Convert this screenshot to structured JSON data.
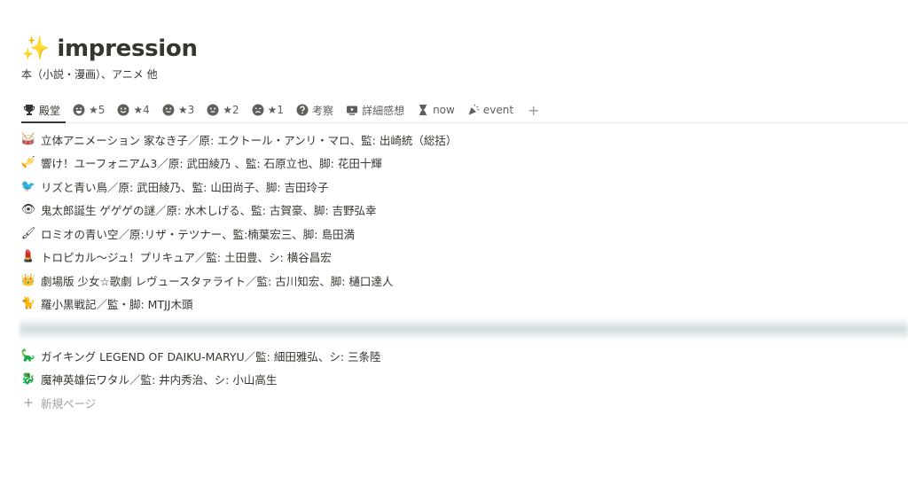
{
  "page": {
    "title_emoji": "✨",
    "title": "impression",
    "subtitle": "本（小説・漫画）、アニメ 他"
  },
  "tabs": [
    {
      "label": "殿堂",
      "icon": "trophy-icon",
      "active": true
    },
    {
      "label": "★5",
      "icon": "grin-face-icon"
    },
    {
      "label": "★4",
      "icon": "smile-face-icon"
    },
    {
      "label": "★3",
      "icon": "neutral-face-icon"
    },
    {
      "label": "★2",
      "icon": "meh-face-icon"
    },
    {
      "label": "★1",
      "icon": "sad-face-icon"
    },
    {
      "label": "考察",
      "icon": "question-icon"
    },
    {
      "label": "詳細感想",
      "icon": "screen-icon"
    },
    {
      "label": "now",
      "icon": "hourglass-icon"
    },
    {
      "label": "event",
      "icon": "party-popper-icon"
    }
  ],
  "tab_add": "+",
  "rows": [
    {
      "icon": "drum-icon",
      "glyph": "🥁",
      "text": "立体アニメーション 家なき子／原: エクトール・アンリ・マロ、監: 出崎統（総括）"
    },
    {
      "icon": "trumpet-icon",
      "glyph": "🎺",
      "text": "響け！ユーフォニアム3／原: 武田綾乃 、監: 石原立也、脚: 花田十輝"
    },
    {
      "icon": "bird-icon",
      "glyph": "🐦",
      "text": "リズと青い鳥／原: 武田綾乃、監: 山田尚子、脚: 吉田玲子"
    },
    {
      "icon": "eye-icon",
      "glyph": "👁",
      "text": "鬼太郎誕生 ゲゲゲの謎／原: 水木しげる、監: 古賀豪、脚: 吉野弘幸"
    },
    {
      "icon": "paintbrush-icon",
      "glyph": "🖌",
      "text": "ロミオの青い空／原:リザ・テツナー、監:楠葉宏三、脚: 島田満"
    },
    {
      "icon": "lipstick-icon",
      "glyph": "💄",
      "text": "トロピカル〜ジュ！プリキュア／監: 土田豊、シ: 横谷昌宏"
    },
    {
      "icon": "crown-icon",
      "glyph": "👑",
      "text": "劇場版 少女☆歌劇 レヴュースタァライト／監: 古川知宏、脚: 樋口達人"
    },
    {
      "icon": "black-cat-icon",
      "glyph": "🐈",
      "text": "羅小黒戦記／監・脚: MTJJ木頭"
    },
    {
      "icon": "dinosaur-icon",
      "glyph": "🦕",
      "text": "ガイキング LEGEND OF DAIKU-MARYU／監: 細田雅弘、シ: 三条陸"
    },
    {
      "icon": "dragon-icon",
      "glyph": "🐉",
      "text": "魔神英雄伝ワタル／監: 井内秀治、シ: 小山高生"
    }
  ],
  "new_page": {
    "plus": "+",
    "label": "新規ページ"
  }
}
